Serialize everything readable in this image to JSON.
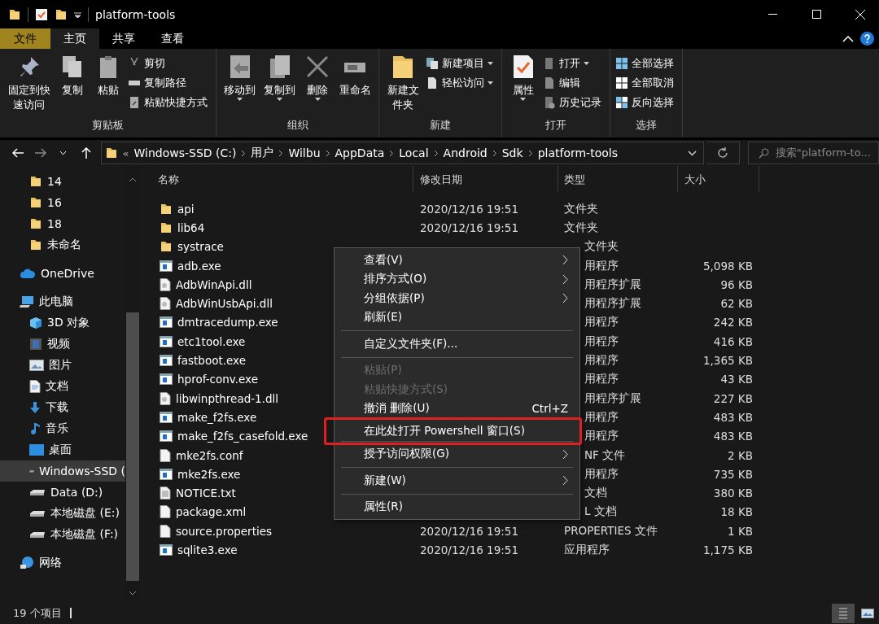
{
  "window": {
    "title": "platform-tools"
  },
  "ribbon_tabs": [
    {
      "label": "文件",
      "kind": "file",
      "selected": false
    },
    {
      "label": "主页",
      "kind": "tab",
      "selected": true
    },
    {
      "label": "共享",
      "kind": "tab",
      "selected": false
    },
    {
      "label": "查看",
      "kind": "tab",
      "selected": false
    }
  ],
  "ribbon": {
    "groups": [
      {
        "label": "剪贴板",
        "large": [
          {
            "label": "固定到快速访问",
            "kind": "pin",
            "dropdown": false
          },
          {
            "label": "复制",
            "kind": "copy",
            "dropdown": false
          },
          {
            "label": "粘贴",
            "kind": "paste",
            "dropdown": false
          }
        ],
        "small": [
          {
            "label": "剪切",
            "kind": "scissors",
            "dropdown": false
          },
          {
            "label": "复制路径",
            "kind": "path",
            "dropdown": false
          },
          {
            "label": "粘贴快捷方式",
            "kind": "shortcut",
            "dropdown": false
          }
        ]
      },
      {
        "label": "组织",
        "large": [
          {
            "label": "移动到",
            "kind": "move",
            "dropdown": true
          },
          {
            "label": "复制到",
            "kind": "copyto",
            "dropdown": true
          },
          {
            "label": "删除",
            "kind": "delete",
            "dropdown": true
          },
          {
            "label": "重命名",
            "kind": "rename",
            "dropdown": false
          }
        ]
      },
      {
        "label": "新建",
        "large": [
          {
            "label": "新建文件夹",
            "kind": "folder",
            "dropdown": false
          }
        ],
        "small": [
          {
            "label": "新建项目",
            "kind": "newitem",
            "dropdown": true
          },
          {
            "label": "轻松访问",
            "kind": "newdoc",
            "dropdown": true
          }
        ]
      },
      {
        "label": "打开",
        "large": [
          {
            "label": "属性",
            "kind": "properties",
            "dropdown": true
          }
        ],
        "small": [
          {
            "label": "打开",
            "kind": "open",
            "dropdown": true
          },
          {
            "label": "编辑",
            "kind": "edit",
            "dropdown": false
          },
          {
            "label": "历史记录",
            "kind": "history",
            "dropdown": false
          }
        ]
      },
      {
        "label": "选择",
        "small": [
          {
            "label": "全部选择",
            "kind": "selectall",
            "dropdown": false
          },
          {
            "label": "全部取消",
            "kind": "selectnone",
            "dropdown": false
          },
          {
            "label": "反向选择",
            "kind": "invert",
            "dropdown": false
          }
        ]
      }
    ]
  },
  "address_bar": {
    "breadcrumbs": [
      "Windows-SSD (C:)",
      "用户",
      "Wilbu",
      "AppData",
      "Local",
      "Android",
      "Sdk",
      "platform-tools"
    ],
    "overflow": "«"
  },
  "search": {
    "placeholder": "搜索\"platform-to..."
  },
  "nav_pane": {
    "folders": [
      {
        "label": "14",
        "selected": false
      },
      {
        "label": "16",
        "selected": false
      },
      {
        "label": "18",
        "selected": false
      },
      {
        "label": "未命名",
        "selected": false
      }
    ],
    "items": [
      {
        "label": "OneDrive",
        "kind": "cloud",
        "selected": false
      },
      {
        "label": "此电脑",
        "kind": "pc",
        "selected": false,
        "children": [
          {
            "label": "3D 对象",
            "kind": "cube",
            "selected": false
          },
          {
            "label": "视频",
            "kind": "video",
            "selected": false
          },
          {
            "label": "图片",
            "kind": "pictures",
            "selected": false
          },
          {
            "label": "文档",
            "kind": "documents",
            "selected": false
          },
          {
            "label": "下载",
            "kind": "download",
            "selected": false
          },
          {
            "label": "音乐",
            "kind": "music",
            "selected": false
          },
          {
            "label": "桌面",
            "kind": "desktop",
            "selected": false
          },
          {
            "label": "Windows-SSD (",
            "kind": "sysdrive",
            "selected": true
          },
          {
            "label": "Data (D:)",
            "kind": "drive",
            "selected": false
          },
          {
            "label": "本地磁盘 (E:)",
            "kind": "drive",
            "selected": false
          },
          {
            "label": "本地磁盘 (F:)",
            "kind": "drive",
            "selected": false
          }
        ]
      },
      {
        "label": "网络",
        "kind": "network",
        "selected": false
      }
    ]
  },
  "file_list": {
    "columns": [
      "名称",
      "修改日期",
      "类型",
      "大小"
    ],
    "rows": [
      {
        "name": "api",
        "kind": "folder",
        "date": "2020/12/16 19:51",
        "type": "文件夹"
      },
      {
        "name": "lib64",
        "kind": "folder",
        "date": "2020/12/16 19:51",
        "type": "文件夹"
      },
      {
        "name": "systrace",
        "kind": "folder",
        "type": "文件夹"
      },
      {
        "name": "adb.exe",
        "kind": "exe",
        "type": "用程序",
        "size": "5,098 KB"
      },
      {
        "name": "AdbWinApi.dll",
        "kind": "dll",
        "type": "用程序扩展",
        "size": "96 KB"
      },
      {
        "name": "AdbWinUsbApi.dll",
        "kind": "dll",
        "type": "用程序扩展",
        "size": "62 KB"
      },
      {
        "name": "dmtracedump.exe",
        "kind": "exe",
        "type": "用程序",
        "size": "242 KB"
      },
      {
        "name": "etc1tool.exe",
        "kind": "exe",
        "type": "用程序",
        "size": "416 KB"
      },
      {
        "name": "fastboot.exe",
        "kind": "exe",
        "type": "用程序",
        "size": "1,365 KB"
      },
      {
        "name": "hprof-conv.exe",
        "kind": "exe",
        "type": "用程序",
        "size": "43 KB"
      },
      {
        "name": "libwinpthread-1.dll",
        "kind": "dll",
        "type": "用程序扩展",
        "size": "227 KB"
      },
      {
        "name": "make_f2fs.exe",
        "kind": "exe",
        "type": "用程序",
        "size": "483 KB"
      },
      {
        "name": "make_f2fs_casefold.exe",
        "kind": "exe",
        "type": "用程序",
        "size": "483 KB"
      },
      {
        "name": "mke2fs.conf",
        "kind": "file",
        "type": "NF 文件",
        "size": "2 KB"
      },
      {
        "name": "mke2fs.exe",
        "kind": "exe",
        "type": "用程序",
        "size": "735 KB"
      },
      {
        "name": "NOTICE.txt",
        "kind": "text",
        "type": "文档",
        "size": "380 KB"
      },
      {
        "name": "package.xml",
        "kind": "file",
        "type": "L 文档",
        "size": "18 KB"
      },
      {
        "name": "source.properties",
        "kind": "file",
        "date": "2020/12/16 19:51",
        "type": "PROPERTIES 文件",
        "size": "1 KB"
      },
      {
        "name": "sqlite3.exe",
        "kind": "exe",
        "date": "2020/12/16 19:51",
        "type": "应用程序",
        "size": "1,175 KB"
      }
    ]
  },
  "context_menu": {
    "items": [
      {
        "kind": "item",
        "label": "查看(V)",
        "submenu": true,
        "disabled": false,
        "highlighted": false
      },
      {
        "kind": "item",
        "label": "排序方式(O)",
        "submenu": true,
        "disabled": false,
        "highlighted": false
      },
      {
        "kind": "item",
        "label": "分组依据(P)",
        "submenu": true,
        "disabled": false,
        "highlighted": false
      },
      {
        "kind": "item",
        "label": "刷新(E)",
        "submenu": false,
        "disabled": false,
        "highlighted": false
      },
      {
        "kind": "separator"
      },
      {
        "kind": "item",
        "label": "自定义文件夹(F)...",
        "submenu": false,
        "disabled": false,
        "highlighted": false
      },
      {
        "kind": "separator"
      },
      {
        "kind": "item",
        "label": "粘贴(P)",
        "submenu": false,
        "disabled": true,
        "highlighted": false
      },
      {
        "kind": "item",
        "label": "粘贴快捷方式(S)",
        "submenu": false,
        "disabled": true,
        "highlighted": false
      },
      {
        "kind": "item",
        "label": "撤消 删除(U)",
        "shortcut": "Ctrl+Z",
        "submenu": false,
        "disabled": false,
        "highlighted": false
      },
      {
        "kind": "item",
        "label": "在此处打开 Powershell 窗口(S)",
        "submenu": false,
        "disabled": false,
        "highlighted": true
      },
      {
        "kind": "separator"
      },
      {
        "kind": "item",
        "label": "授予访问权限(G)",
        "submenu": true,
        "disabled": false,
        "highlighted": false
      },
      {
        "kind": "separator"
      },
      {
        "kind": "item",
        "label": "新建(W)",
        "submenu": true,
        "disabled": false,
        "highlighted": false
      },
      {
        "kind": "separator"
      },
      {
        "kind": "item",
        "label": "属性(R)",
        "submenu": false,
        "disabled": false,
        "highlighted": false
      }
    ]
  },
  "status_bar": {
    "item_count": "19 个项目",
    "view_buttons": [
      {
        "kind": "details",
        "selected": true
      },
      {
        "kind": "large_icons",
        "selected": false
      }
    ]
  }
}
